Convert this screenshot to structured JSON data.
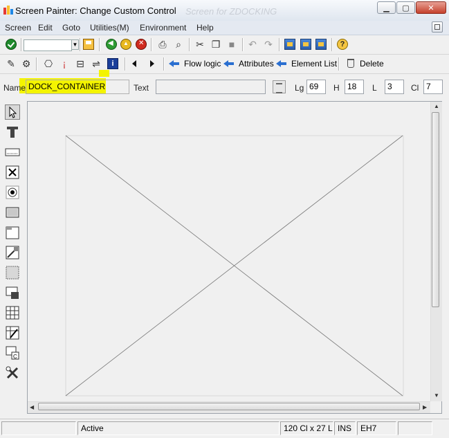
{
  "window": {
    "title": "Screen Painter:  Change Custom Control",
    "background_title": "Screen for ZDOCKING"
  },
  "menu": {
    "items": [
      "Screen",
      "Edit",
      "Goto",
      "Utilities(M)",
      "Environment",
      "Help"
    ]
  },
  "toolbar2": {
    "flow_logic": "Flow logic",
    "attributes": "Attributes",
    "element_list": "Element List",
    "delete": "Delete"
  },
  "attributes": {
    "name_label": "Name",
    "name_value": "DOCK_CONTAINER",
    "text_label": "Text",
    "text_value": "",
    "lg_label": "Lg",
    "lg_value": "69",
    "h_label": "H",
    "h_value": "18",
    "l_label": "L",
    "l_value": "3",
    "cl_label": "Cl",
    "cl_value": "7"
  },
  "palette": {
    "items": [
      "pointer-icon",
      "text-field-icon",
      "input-field-icon",
      "checkbox-icon",
      "radio-button-icon",
      "pushbutton-icon",
      "frame-icon",
      "subscreen-icon",
      "tabstrip-icon",
      "table-control-icon",
      "table-wizard-icon",
      "custom-control-icon",
      "status-icon"
    ]
  },
  "status": {
    "state": "Active",
    "position": "120 Cl x 27 L",
    "mode": "INS",
    "server": "EH7"
  },
  "colors": {
    "highlight": "#f4f400",
    "accent_blue": "#2a6fd0"
  }
}
